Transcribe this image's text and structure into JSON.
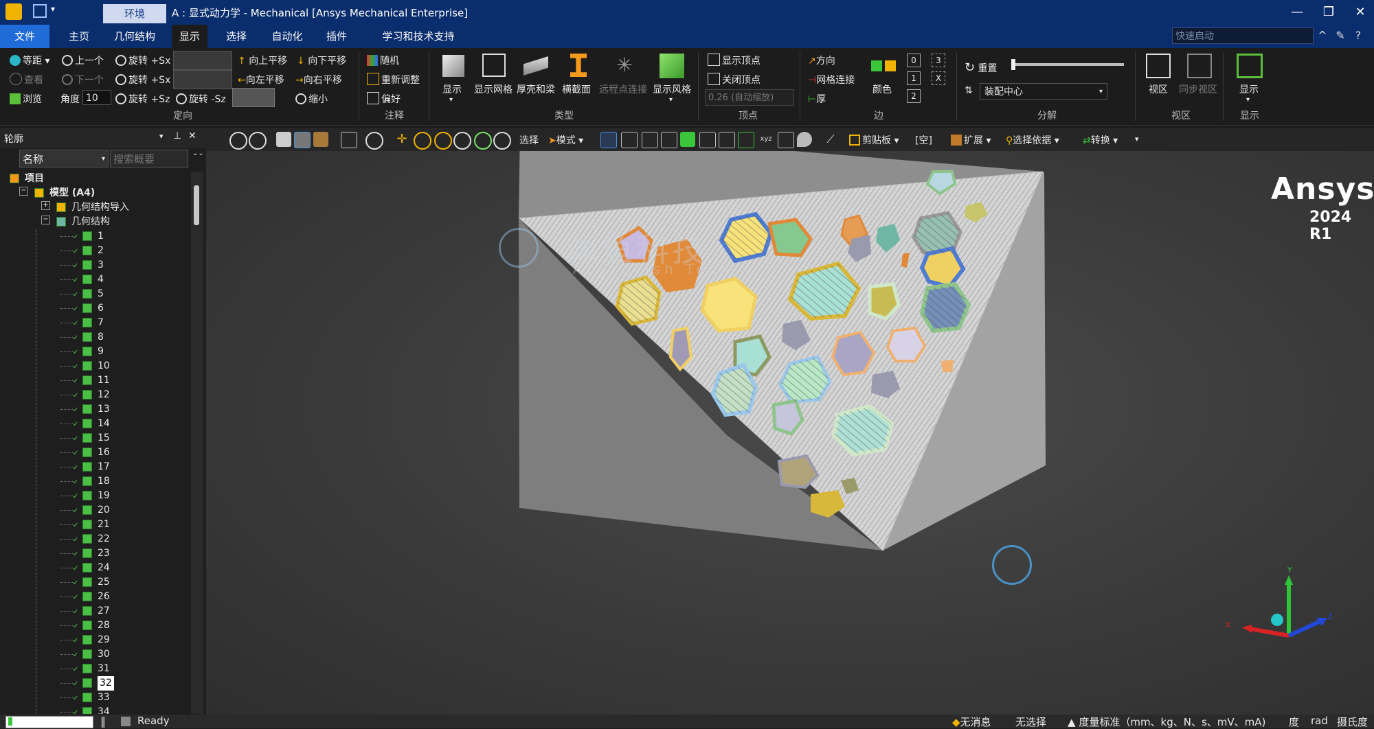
{
  "titlebar": {
    "env_tab": "环境",
    "title": "A : 显式动力学 - Mechanical [Ansys Mechanical Enterprise]"
  },
  "menubar": {
    "items": [
      "文件",
      "主页",
      "几何结构",
      "显示",
      "选择",
      "自动化",
      "插件",
      "学习和技术支持"
    ],
    "active": "显示",
    "quick_launch_placeholder": "快速启动"
  },
  "ribbon": {
    "orient": {
      "iso": "等距",
      "look": "查看",
      "browse": "浏览",
      "prev": "上一个",
      "next": "下一个",
      "angle_label": "角度",
      "angle_value": "10",
      "rot_sx_plus1": "旋转 +Sx",
      "rot_sx_plus2": "旋转 +Sx",
      "rot_sz_plus": "旋转 +Sz",
      "rot_sz_minus": "旋转 -Sz",
      "pan_up": "向上平移",
      "pan_down": "向下平移",
      "pan_left": "向左平移",
      "pan_right": "向右平移",
      "zoom_out": "缩小",
      "group": "定向"
    },
    "annot": {
      "random": "随机",
      "readjust": "重新调整",
      "prefs": "偏好",
      "group": "注释"
    },
    "type": {
      "show": "显示",
      "show_mesh": "显示网格",
      "shell_beam": "厚壳和梁",
      "cross_section": "横截面",
      "remote_points": "远程点连接",
      "show_style": "显示风格",
      "group": "类型"
    },
    "vertex": {
      "show_vertices": "显示顶点",
      "close_vertices": "关闭顶点",
      "auto_scale": "0.26 (自动缩放)",
      "group": "顶点"
    },
    "edge": {
      "direction": "方向",
      "mesh_connect": "网格连接",
      "thick": "厚",
      "color": "颜色",
      "count0": "0",
      "count1": "1",
      "count2": "2",
      "count3": "3",
      "countx": "X",
      "group": "边"
    },
    "explode": {
      "reset": "重置",
      "assembly_center": "装配中心",
      "group": "分解"
    },
    "view": {
      "view": "视区",
      "sync_view": "同步视区",
      "group": "视区"
    },
    "display": {
      "show": "显示",
      "group": "显示"
    }
  },
  "toolbar": {
    "select": "选择",
    "mode": "模式",
    "clipboard": "剪贴板",
    "empty": "[空]",
    "extend": "扩展",
    "select_by": "选择依据",
    "convert": "转换"
  },
  "outline": {
    "title": "轮廓",
    "name_col": "名称",
    "search_placeholder": "搜索概要",
    "project": "项目",
    "model": "模型 (A4)",
    "geom_import": "几何结构导入",
    "geometry": "几何结构",
    "bodies": [
      "1",
      "2",
      "3",
      "4",
      "5",
      "6",
      "7",
      "8",
      "9",
      "10",
      "11",
      "12",
      "13",
      "14",
      "15",
      "16",
      "17",
      "18",
      "19",
      "20",
      "21",
      "22",
      "23",
      "24",
      "25",
      "26",
      "27",
      "28",
      "29",
      "30",
      "31",
      "32",
      "33",
      "34"
    ],
    "selected_body": "32"
  },
  "viewport": {
    "brand": "Ansys",
    "version": "2024 R1",
    "watermark_cn": "渊鱼科技",
    "watermark_en": "AbyssFish Tech",
    "axis_x": "X",
    "axis_y": "Y",
    "axis_z": "Z"
  },
  "status": {
    "ready": "Ready",
    "messages": "无消息",
    "selection": "无选择",
    "units": "度量标准（mm、kg、N、s、mV、mA)",
    "degree": "度",
    "rad": "rad",
    "celsius": "摄氏度"
  },
  "colors": {
    "title_bg": "#0a2d6e",
    "file_tab": "#1f6bd8",
    "ribbon_bg": "#1c1c1c",
    "accent_green": "#4bbf45"
  }
}
